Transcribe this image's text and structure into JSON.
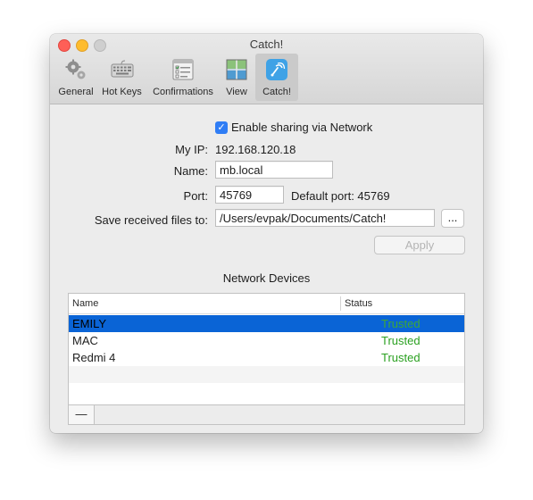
{
  "window": {
    "title": "Catch!"
  },
  "toolbar": {
    "items": [
      {
        "label": "General",
        "icon": "gear-icon"
      },
      {
        "label": "Hot Keys",
        "icon": "keyboard-icon"
      },
      {
        "label": "Confirmations",
        "icon": "checklist-icon"
      },
      {
        "label": "View",
        "icon": "view-icon"
      },
      {
        "label": "Catch!",
        "icon": "catch-icon",
        "selected": true
      }
    ]
  },
  "settings": {
    "enable_sharing_label": "Enable sharing via Network",
    "enable_sharing_checked": true,
    "my_ip_label": "My IP:",
    "my_ip_value": "192.168.120.18",
    "name_label": "Name:",
    "name_value": "mb.local",
    "port_label": "Port:",
    "port_value": "45769",
    "default_port_text": "Default port: 45769",
    "save_label": "Save received files to:",
    "save_path": "/Users/evpak/Documents/Catch!",
    "browse_label": "...",
    "apply_label": "Apply"
  },
  "devices": {
    "title": "Network Devices",
    "columns": {
      "name": "Name",
      "status": "Status"
    },
    "rows": [
      {
        "name": "EMILY",
        "status": "Trusted"
      },
      {
        "name": "MAC",
        "status": "Trusted"
      },
      {
        "name": "Redmi 4",
        "status": "Trusted"
      }
    ],
    "remove_label": "—"
  },
  "colors": {
    "accent": "#2f7df5",
    "selection": "#0a64d6",
    "trusted": "#2aa020"
  }
}
